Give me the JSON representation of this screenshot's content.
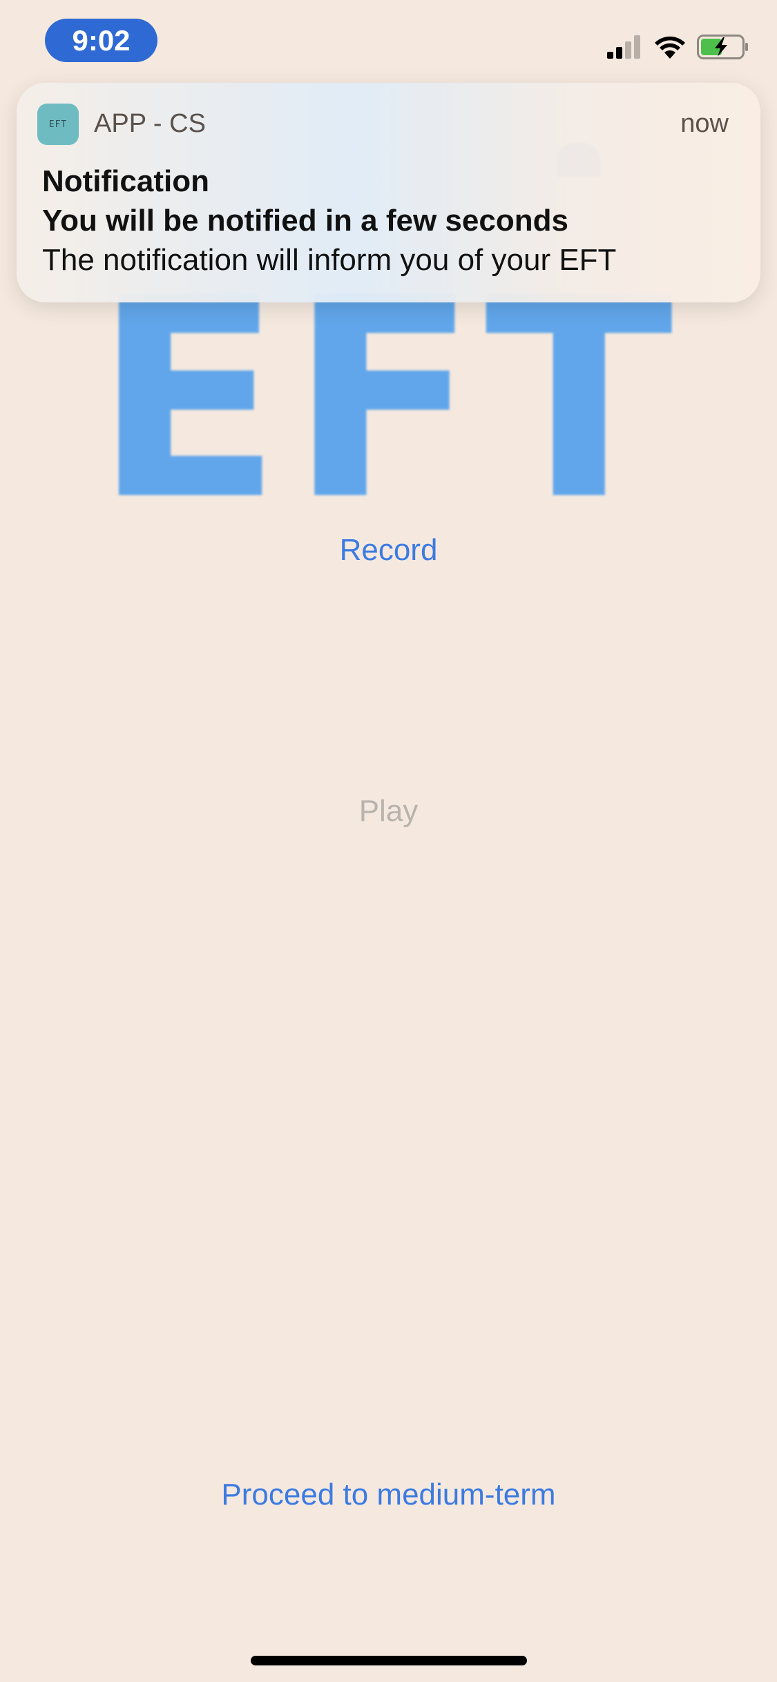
{
  "status_bar": {
    "time": "9:02",
    "signal_icon": "cellular-signal-icon",
    "wifi_icon": "wifi-icon",
    "battery_icon": "battery-charging-icon",
    "time_pill_color": "#2F69D4"
  },
  "background_logo": {
    "text": "EFT",
    "color": "#61A6EA"
  },
  "notification": {
    "app_icon_text": "EFT",
    "app_name": "APP - CS",
    "time": "now",
    "title": "Notification",
    "subtitle": "You will be notified in a few seconds",
    "body": "The notification will inform you of your EFT"
  },
  "buttons": {
    "record": "Record",
    "play": "Play",
    "proceed": "Proceed to medium-term"
  },
  "colors": {
    "background": "#F5E9DF",
    "accent": "#3C7BE1",
    "disabled": "#B9B3AE"
  }
}
